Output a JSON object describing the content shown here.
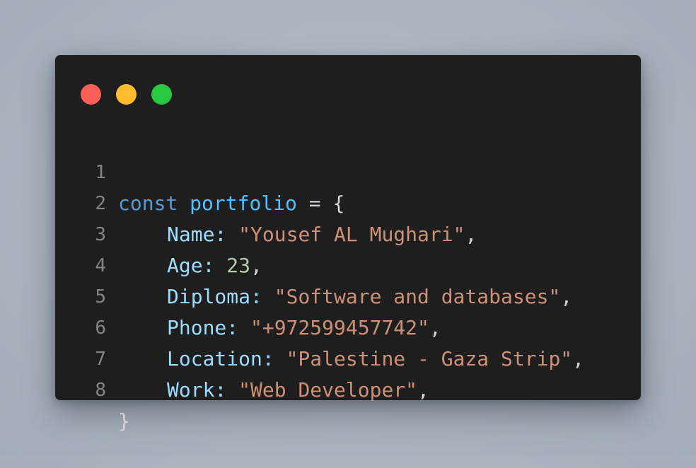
{
  "window": {
    "controls": [
      {
        "name": "close",
        "color": "#ff5f57"
      },
      {
        "name": "minimize",
        "color": "#febc2e"
      },
      {
        "name": "maximize",
        "color": "#28c840"
      }
    ]
  },
  "code": {
    "line_numbers": [
      "1",
      "2",
      "3",
      "4",
      "5",
      "6",
      "7",
      "8"
    ],
    "line1": {
      "keyword": "const",
      "variable": "portfolio",
      "rest": " = {"
    },
    "entries": [
      {
        "key": "Name",
        "colon": ": ",
        "value": "\"Yousef AL Mughari\"",
        "type": "string",
        "trail": ","
      },
      {
        "key": "Age",
        "colon": ": ",
        "value": "23",
        "type": "number",
        "trail": ","
      },
      {
        "key": "Diploma",
        "colon": ": ",
        "value": "\"Software and databases\"",
        "type": "string",
        "trail": ","
      },
      {
        "key": "Phone",
        "colon": ": ",
        "value": "\"+972599457742\"",
        "type": "string",
        "trail": ","
      },
      {
        "key": "Location",
        "colon": ": ",
        "value": "\"Palestine - Gaza Strip\"",
        "type": "string",
        "trail": ","
      },
      {
        "key": "Work",
        "colon": ": ",
        "value": "\"Web Developer\"",
        "type": "string",
        "trail": ","
      }
    ],
    "closing": "}"
  },
  "colors": {
    "keyword": "#569cd6",
    "variable": "#4fc1ff",
    "property": "#9cdcfe",
    "string": "#ce9178",
    "number": "#b5cea8",
    "background": "#1e1e1e"
  }
}
